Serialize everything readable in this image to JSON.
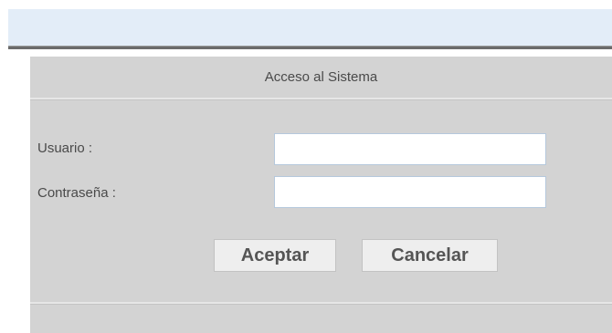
{
  "login": {
    "title": "Acceso al Sistema",
    "username_label": "Usuario :",
    "username_value": "",
    "password_label": "Contraseña :",
    "password_value": "",
    "accept_label": "Aceptar",
    "cancel_label": "Cancelar"
  },
  "colors": {
    "header_band": "#e3edf8",
    "panel_background": "#d3d3d3",
    "input_border": "#b5c8dc"
  }
}
